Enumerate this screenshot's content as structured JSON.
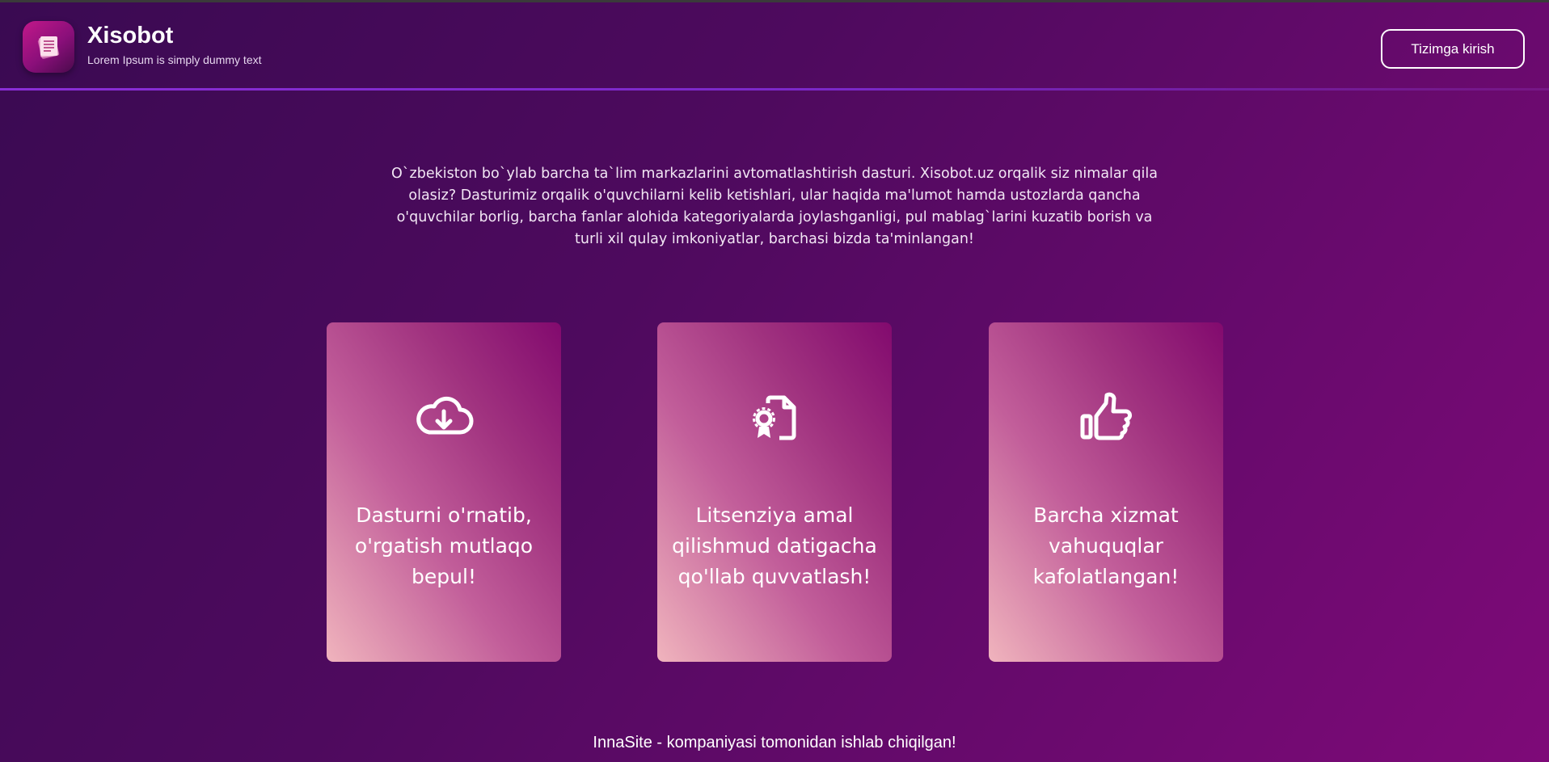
{
  "header": {
    "brand_title": "Xisobot",
    "brand_subtitle": "Lorem Ipsum is simply dummy text",
    "login_label": "Tizimga kirish",
    "logo_icon": "document-stack-icon"
  },
  "intro": {
    "text": "O`zbekiston bo`ylab barcha ta`lim markazlarini avtomatlashtirish dasturi. Xisobot.uz orqalik siz nimalar qila olasiz? Dasturimiz orqalik o'quvchilarni kelib ketishlari, ular haqida ma'lumot hamda ustozlarda qancha o'quvchilar borlig, barcha fanlar alohida kategoriyalarda joylashganligi, pul mablag`larini kuzatib borish va turli xil qulay imkoniyatlar, barchasi bizda ta'minlangan!"
  },
  "cards": [
    {
      "icon": "cloud-download-icon",
      "text": "Dasturni o'rnatib, o'rgatish mutlaqo bepul!"
    },
    {
      "icon": "certificate-document-icon",
      "text": "Litsenziya amal qilishmud datigacha qo'llab quvvatlash!"
    },
    {
      "icon": "thumbs-up-icon",
      "text": "Barcha xizmat vahuquqlar kafolatlangan!"
    }
  ],
  "footer": {
    "text": "InnaSite - kompaniyasi tomonidan ishlab chiqilgan!"
  },
  "colors": {
    "background_start": "#3a0a52",
    "background_end": "#7e0a78",
    "divider": "#8a2ed6",
    "card_light": "#f0b4bd",
    "card_dark": "#820a6e"
  }
}
